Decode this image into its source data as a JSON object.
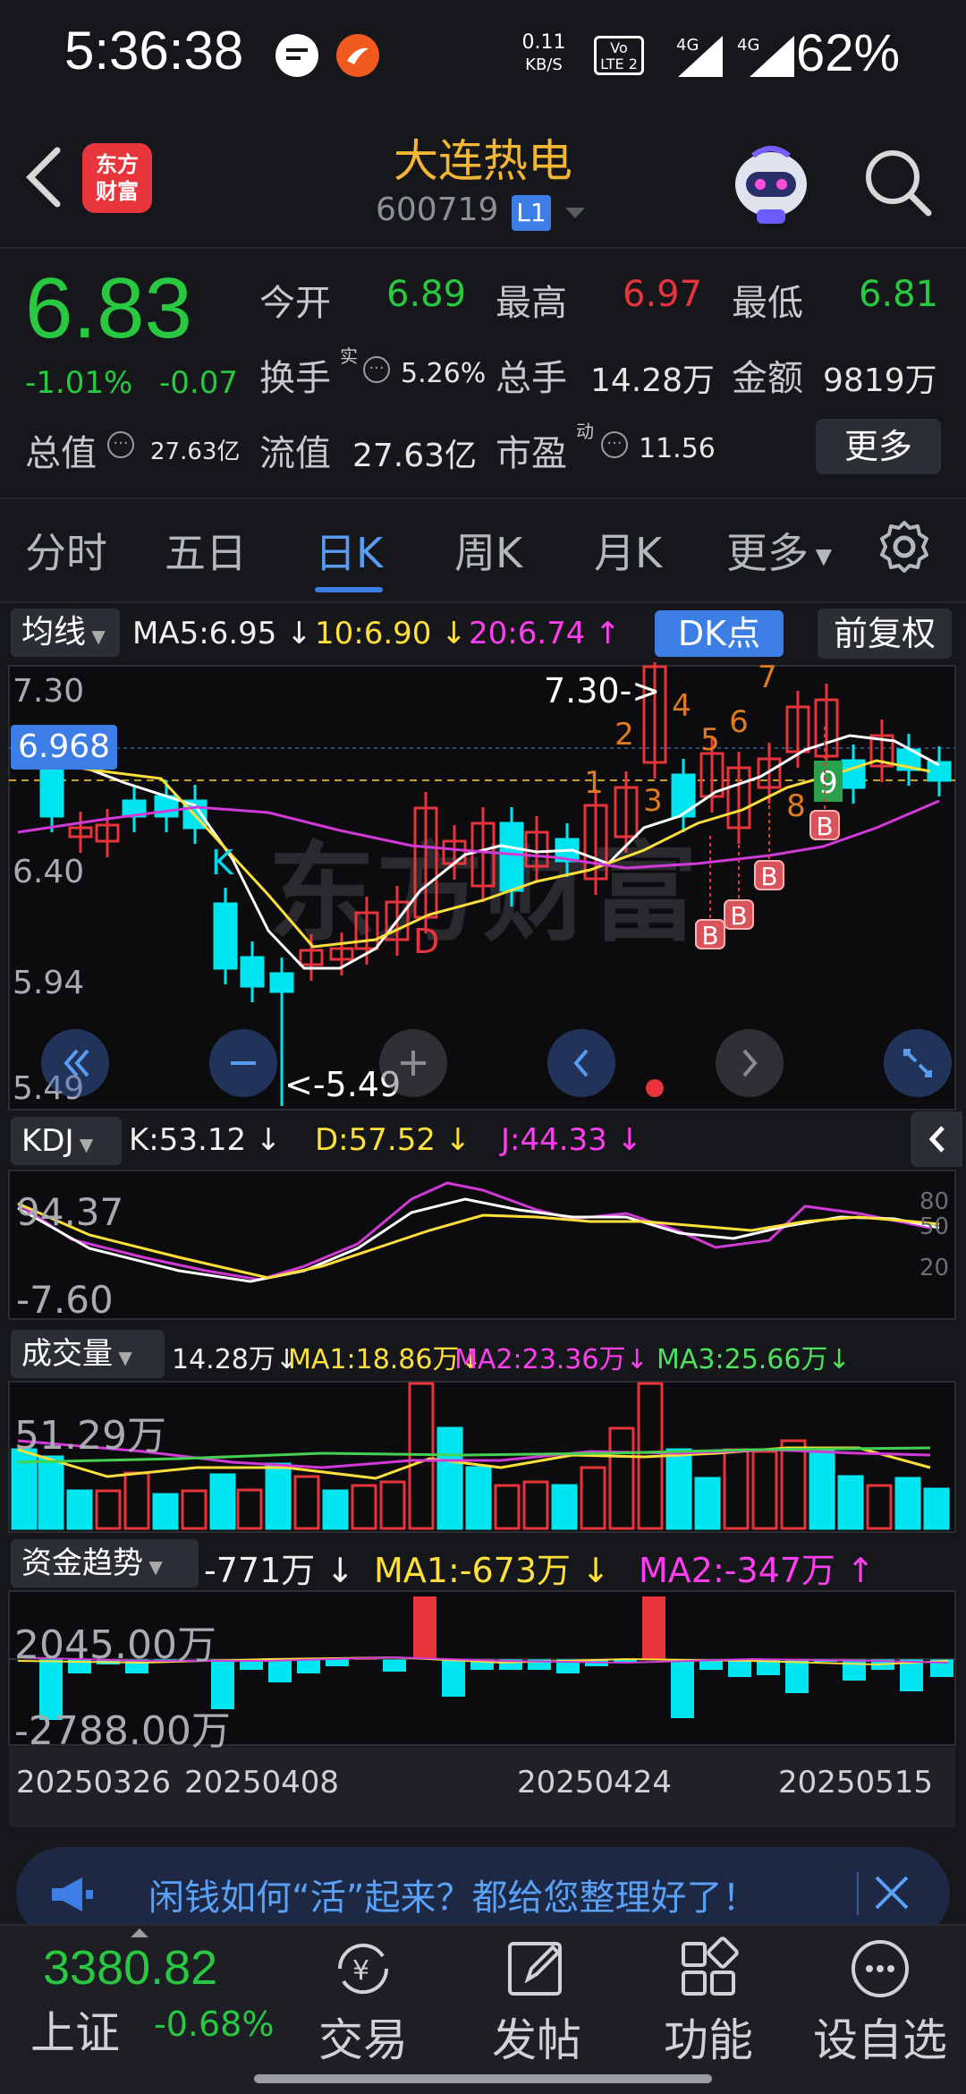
{
  "status_bar": {
    "time": "5:36:38",
    "net_speed_value": "0.11",
    "net_speed_unit": "KB/S",
    "volte_label": "LTE 2",
    "signal1": "4G",
    "signal2": "4G",
    "battery": "62%"
  },
  "header": {
    "logo_text_line1": "东方",
    "logo_text_line2": "财富",
    "stock_name": "大连热电",
    "stock_code": "600719",
    "level_badge": "L1"
  },
  "quote": {
    "price": "6.83",
    "change_pct": "-1.01%",
    "change": "-0.07",
    "open_label": "今开",
    "open": "6.89",
    "high_label": "最高",
    "high": "6.97",
    "low_label": "最低",
    "low": "6.81",
    "turnover_label": "换手",
    "turnover_sup": "实",
    "turnover": "5.26%",
    "volume_label": "总手",
    "volume": "14.28万",
    "amount_label": "金额",
    "amount": "9819万",
    "mktcap_label": "总值",
    "mktcap": "27.63亿",
    "float_label": "流值",
    "float": "27.63亿",
    "pe_label": "市盈",
    "pe_sup": "动",
    "pe": "11.56",
    "more_label": "更多"
  },
  "tabs": [
    {
      "label": "分时"
    },
    {
      "label": "五日"
    },
    {
      "label": "日K"
    },
    {
      "label": "周K"
    },
    {
      "label": "月K"
    },
    {
      "label": "更多"
    }
  ],
  "ma_row": {
    "selector": "均线",
    "ma5": "MA5:6.95",
    "ma10": "10:6.90",
    "ma20": "20:6.74",
    "dk_label": "DK点",
    "fq_label": "前复权"
  },
  "kline": {
    "axis_labels": [
      "7.30",
      "6.968",
      "6.40",
      "5.94",
      "5.49"
    ],
    "high_marker": "7.30->",
    "low_marker": "<-5.49",
    "k_mark": "K",
    "d_mark": "D",
    "seq_numbers": [
      "1",
      "2",
      "3",
      "4",
      "5",
      "6",
      "7",
      "8",
      "9"
    ],
    "buy_mark": "B"
  },
  "kdj_row": {
    "selector": "KDJ",
    "k": "K:53.12",
    "d": "D:57.52",
    "j": "J:44.33",
    "axis_top": "94.37",
    "axis_bottom": "-7.60",
    "levels": [
      "80",
      "50",
      "20"
    ]
  },
  "volume_row": {
    "selector": "成交量",
    "vol": "14.28万",
    "ma1": "MA1:18.86万",
    "ma2": "MA2:23.36万",
    "ma3": "MA3:25.66万",
    "axis_top": "51.29万"
  },
  "fund_row": {
    "selector": "资金趋势",
    "value": "-771万",
    "ma1": "MA1:-673万",
    "ma2": "MA2:-347万",
    "axis_top": "2045.00万",
    "axis_bottom": "-2788.00万"
  },
  "date_axis": [
    "20250326",
    "20250408",
    "20250424",
    "20250515"
  ],
  "banner": {
    "text": "闲钱如何“活”起来？都给您整理好了！"
  },
  "bottom_bar": {
    "index_value": "3380.82",
    "index_name": "上证",
    "index_pct": "-0.68%",
    "items": [
      {
        "label": "交易",
        "icon": "yen-exchange-icon"
      },
      {
        "label": "发帖",
        "icon": "edit-icon"
      },
      {
        "label": "功能",
        "icon": "grid-icon"
      },
      {
        "label": "设自选",
        "icon": "more-dots-icon"
      }
    ]
  },
  "colors": {
    "up": "#e8343b",
    "down": "#00e6f0",
    "price_down": "#28c840",
    "accent": "#3d7ee6",
    "ma5": "#ffffff",
    "ma10": "#ffe03a",
    "ma20": "#d13ad8"
  }
}
